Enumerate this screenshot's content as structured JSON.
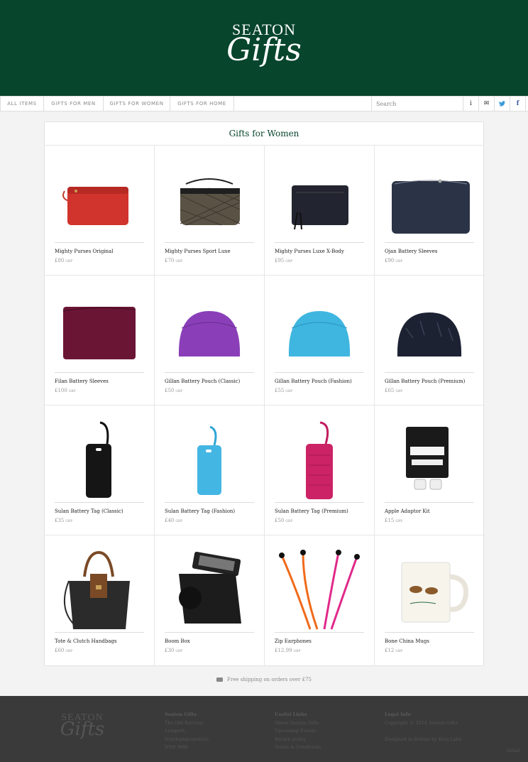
{
  "brand": {
    "line1": "SEATON",
    "line2": "Gifts"
  },
  "nav": {
    "items": [
      "ALL ITEMS",
      "GIFTS FOR MEN",
      "GIFTS FOR WOMEN",
      "GIFTS FOR HOME"
    ],
    "search_placeholder": "Search",
    "icons": [
      "info-icon",
      "envelope-icon",
      "twitter-icon",
      "facebook-icon"
    ],
    "icon_glyphs": [
      "i",
      "✉",
      "🐦",
      "f"
    ]
  },
  "page_title": "Gifts for Women",
  "currency": "GBP",
  "products": [
    {
      "name": "Mighty Purses Original",
      "price": "£80"
    },
    {
      "name": "Mighty Purses Sport Luxe",
      "price": "£70"
    },
    {
      "name": "Mighty Purses Luxe X-Body",
      "price": "£95"
    },
    {
      "name": "Ojan Battery Sleeves",
      "price": "£90"
    },
    {
      "name": "Filan Battery Sleeves",
      "price": "£100"
    },
    {
      "name": "Gillan Battery Pouch (Classic)",
      "price": "£50"
    },
    {
      "name": "Gillan Battery Pouch (Fashion)",
      "price": "£55"
    },
    {
      "name": "Gillan Battery Pouch (Premium)",
      "price": "£65"
    },
    {
      "name": "Sulan Battery Tag (Classic)",
      "price": "£35"
    },
    {
      "name": "Sulan Battery Tag (Fashion)",
      "price": "£40"
    },
    {
      "name": "Sulan Battery Tag (Premium)",
      "price": "£50"
    },
    {
      "name": "Apple Adaptor Kit",
      "price": "£15"
    },
    {
      "name": "Tote & Clutch Handbags",
      "price": "£60"
    },
    {
      "name": "Boom Box",
      "price": "£30"
    },
    {
      "name": "Zip Earphones",
      "price": "£12.99"
    },
    {
      "name": "Bone China Mugs",
      "price": "£12"
    }
  ],
  "shipping_note": "Free shipping on orders over £75",
  "footer": {
    "address_title": "Seaton Gifts",
    "address_lines": [
      "The Old Rectory,",
      "Lamport,",
      "Northamptonshire,",
      "NN6 9HB"
    ],
    "links_title": "Useful Links",
    "links": [
      "About Seaton Gifts",
      "Upcoming Events",
      "Return policy",
      "Terms & Conditions"
    ],
    "legal_title": "Legal Info",
    "legal_lines": [
      "Copyright © 2014 Seaton Gifts",
      "",
      "Designed in Britain by Kooj Labs"
    ],
    "detail_link": "Detail"
  }
}
